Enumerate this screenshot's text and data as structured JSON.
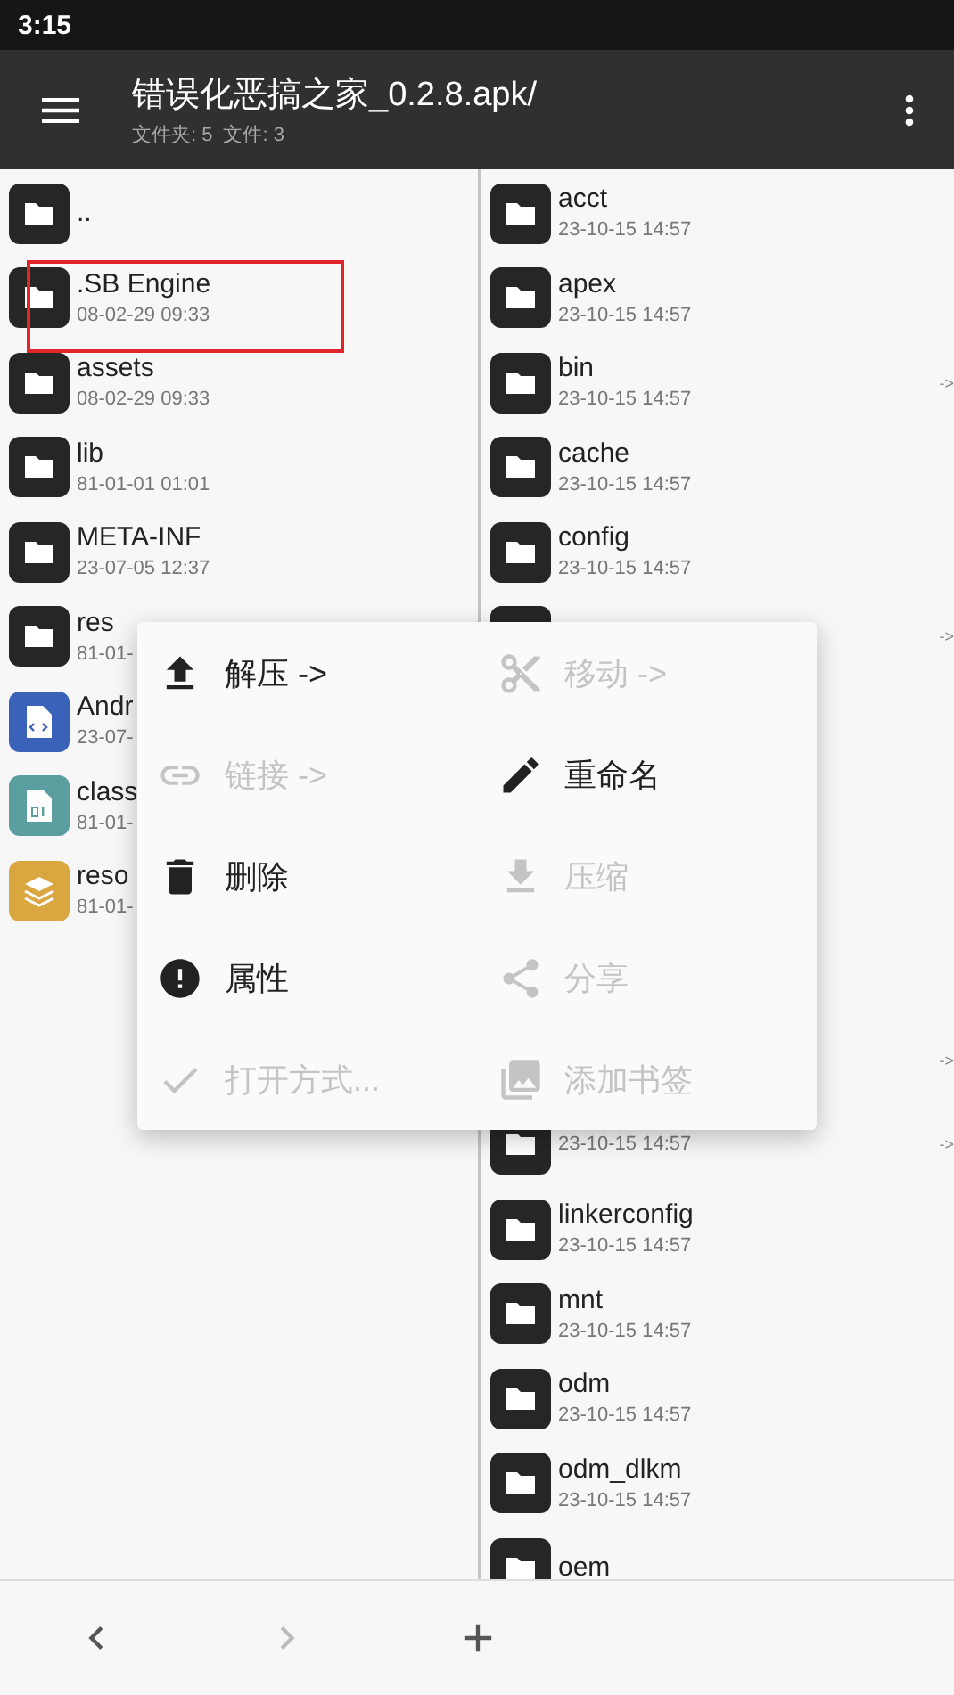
{
  "status_bar": {
    "time": "3:15"
  },
  "app_bar": {
    "title": "错误化恶搞之家_0.2.8.apk/",
    "folder_count": "文件夹: 5",
    "file_count": "文件: 3"
  },
  "left_rows": [
    {
      "kind": "folder",
      "name": "..",
      "marked": false
    },
    {
      "kind": "folder",
      "name": ".SB Engine",
      "date": "08-02-29 09:33",
      "marked": true
    },
    {
      "kind": "folder",
      "name": "assets",
      "date": "08-02-29 09:33",
      "marked": false
    },
    {
      "kind": "folder",
      "name": "lib",
      "date": "81-01-01 01:01",
      "marked": false
    },
    {
      "kind": "folder",
      "name": "META-INF",
      "date": "23-07-05 12:37",
      "marked": false
    },
    {
      "kind": "folder",
      "name": "res",
      "date": "81-01-",
      "marked": false
    },
    {
      "kind": "xml",
      "name": "Andr",
      "date": "23-07-",
      "marked": false
    },
    {
      "kind": "dex",
      "name": "class",
      "date": "81-01-",
      "marked": false
    },
    {
      "kind": "arsc",
      "name": "reso",
      "date": "81-01-",
      "marked": false
    }
  ],
  "right_pane": {
    "upper_rows": [
      {
        "name": "acct",
        "date": "23-10-15 14:57"
      },
      {
        "name": "apex",
        "date": "23-10-15 14:57"
      },
      {
        "name": "bin",
        "date": "23-10-15 14:57",
        "link_mark": "->"
      },
      {
        "name": "cache",
        "date": "23-10-15 14:57"
      },
      {
        "name": "config",
        "date": "23-10-15 14:57"
      },
      {
        "kind": "folder",
        "link_mark": "->"
      }
    ],
    "lower_rows": [
      {
        "kind": "link_only",
        "link_mark": "->"
      },
      {
        "kind": "folder",
        "date": "23-10-15 14:57",
        "link_mark": "->"
      },
      {
        "name": "linkerconfig",
        "date": "23-10-15 14:57"
      },
      {
        "name": "mnt",
        "date": "23-10-15 14:57"
      },
      {
        "name": "odm",
        "date": "23-10-15 14:57"
      },
      {
        "name": "odm_dlkm",
        "date": "23-10-15 14:57"
      },
      {
        "name": "oem"
      }
    ]
  },
  "context_menu": [
    {
      "label": "解压 ->",
      "disabled": false
    },
    {
      "label": "移动 ->",
      "disabled": true
    },
    {
      "label": "链接 ->",
      "disabled": true
    },
    {
      "label": "重命名",
      "disabled": false
    },
    {
      "label": "删除",
      "disabled": false
    },
    {
      "label": "压缩",
      "disabled": true
    },
    {
      "label": "属性",
      "disabled": false
    },
    {
      "label": "分享",
      "disabled": true
    },
    {
      "label": "打开方式...",
      "disabled": true
    },
    {
      "label": "添加书签",
      "disabled": true
    }
  ],
  "bottom_bar": [
    {
      "disabled": false
    },
    {
      "disabled": true
    },
    {
      "disabled": false
    }
  ]
}
